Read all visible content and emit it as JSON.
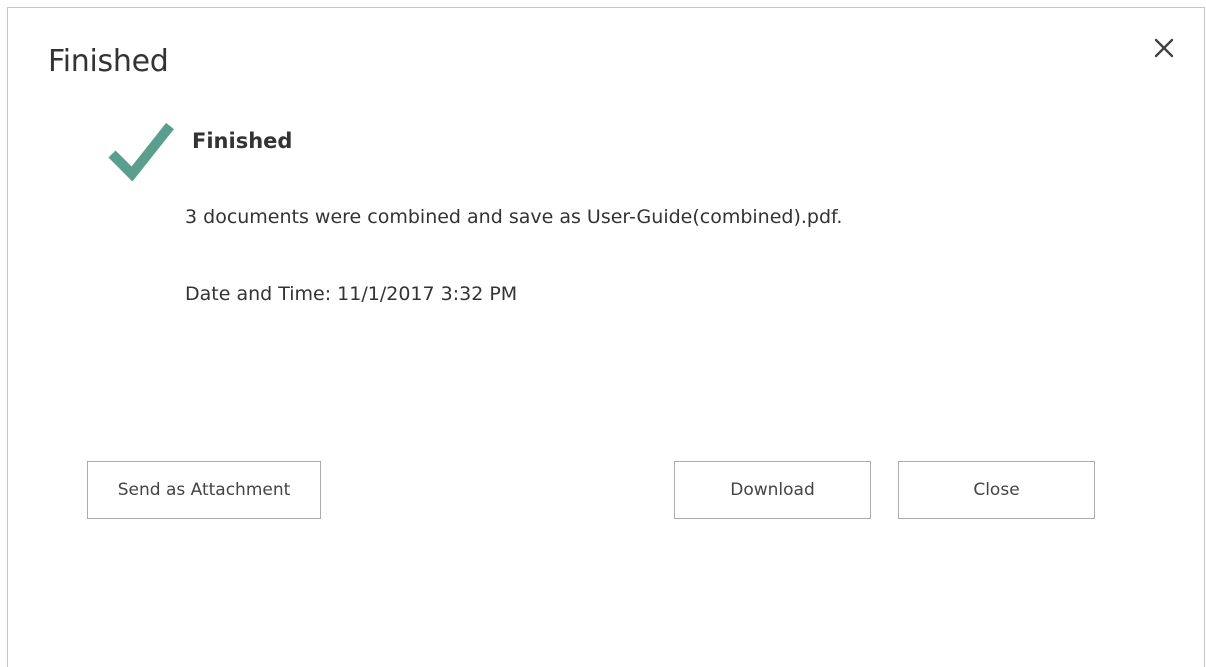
{
  "dialog": {
    "title": "Finished",
    "close_icon": "close-icon",
    "status": {
      "icon": "checkmark-icon",
      "icon_color": "#5a9e8d",
      "heading": "Finished",
      "message": "3 documents were combined and save as User-Guide(combined).pdf.",
      "datetime": "Date and Time: 11/1/2017 3:32 PM"
    },
    "buttons": {
      "send_attachment": "Send as Attachment",
      "download": "Download",
      "close": "Close"
    }
  }
}
